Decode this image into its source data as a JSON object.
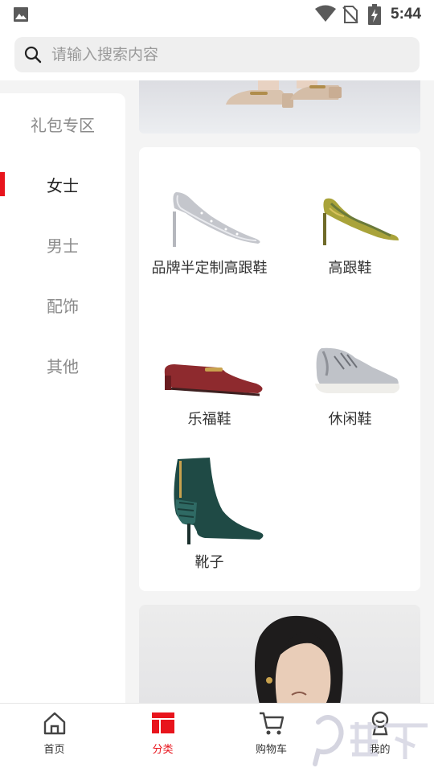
{
  "status_bar": {
    "time": "5:44"
  },
  "search": {
    "placeholder": "请输入搜索内容"
  },
  "sidebar": {
    "items": [
      {
        "label": "礼包专区",
        "active": false
      },
      {
        "label": "女士",
        "active": true
      },
      {
        "label": "男士",
        "active": false
      },
      {
        "label": "配饰",
        "active": false
      },
      {
        "label": "其他",
        "active": false
      }
    ]
  },
  "categories": [
    {
      "label": "品牌半定制高跟鞋",
      "icon": "silver-pump-shoe"
    },
    {
      "label": "高跟鞋",
      "icon": "yellow-snakeskin-pump"
    },
    {
      "label": "乐福鞋",
      "icon": "burgundy-loafer"
    },
    {
      "label": "休闲鞋",
      "icon": "silver-sneaker"
    },
    {
      "label": "靴子",
      "icon": "green-ankle-boot"
    }
  ],
  "tabbar": {
    "tabs": [
      {
        "label": "首页",
        "icon": "home-icon",
        "active": false
      },
      {
        "label": "分类",
        "icon": "category-icon",
        "active": true
      },
      {
        "label": "购物车",
        "icon": "cart-icon",
        "active": false
      },
      {
        "label": "我的",
        "icon": "profile-icon",
        "active": false
      }
    ]
  },
  "colors": {
    "accent": "#e8141c",
    "sidebar_active_text": "#222222",
    "sidebar_text": "#8a8a8a"
  }
}
